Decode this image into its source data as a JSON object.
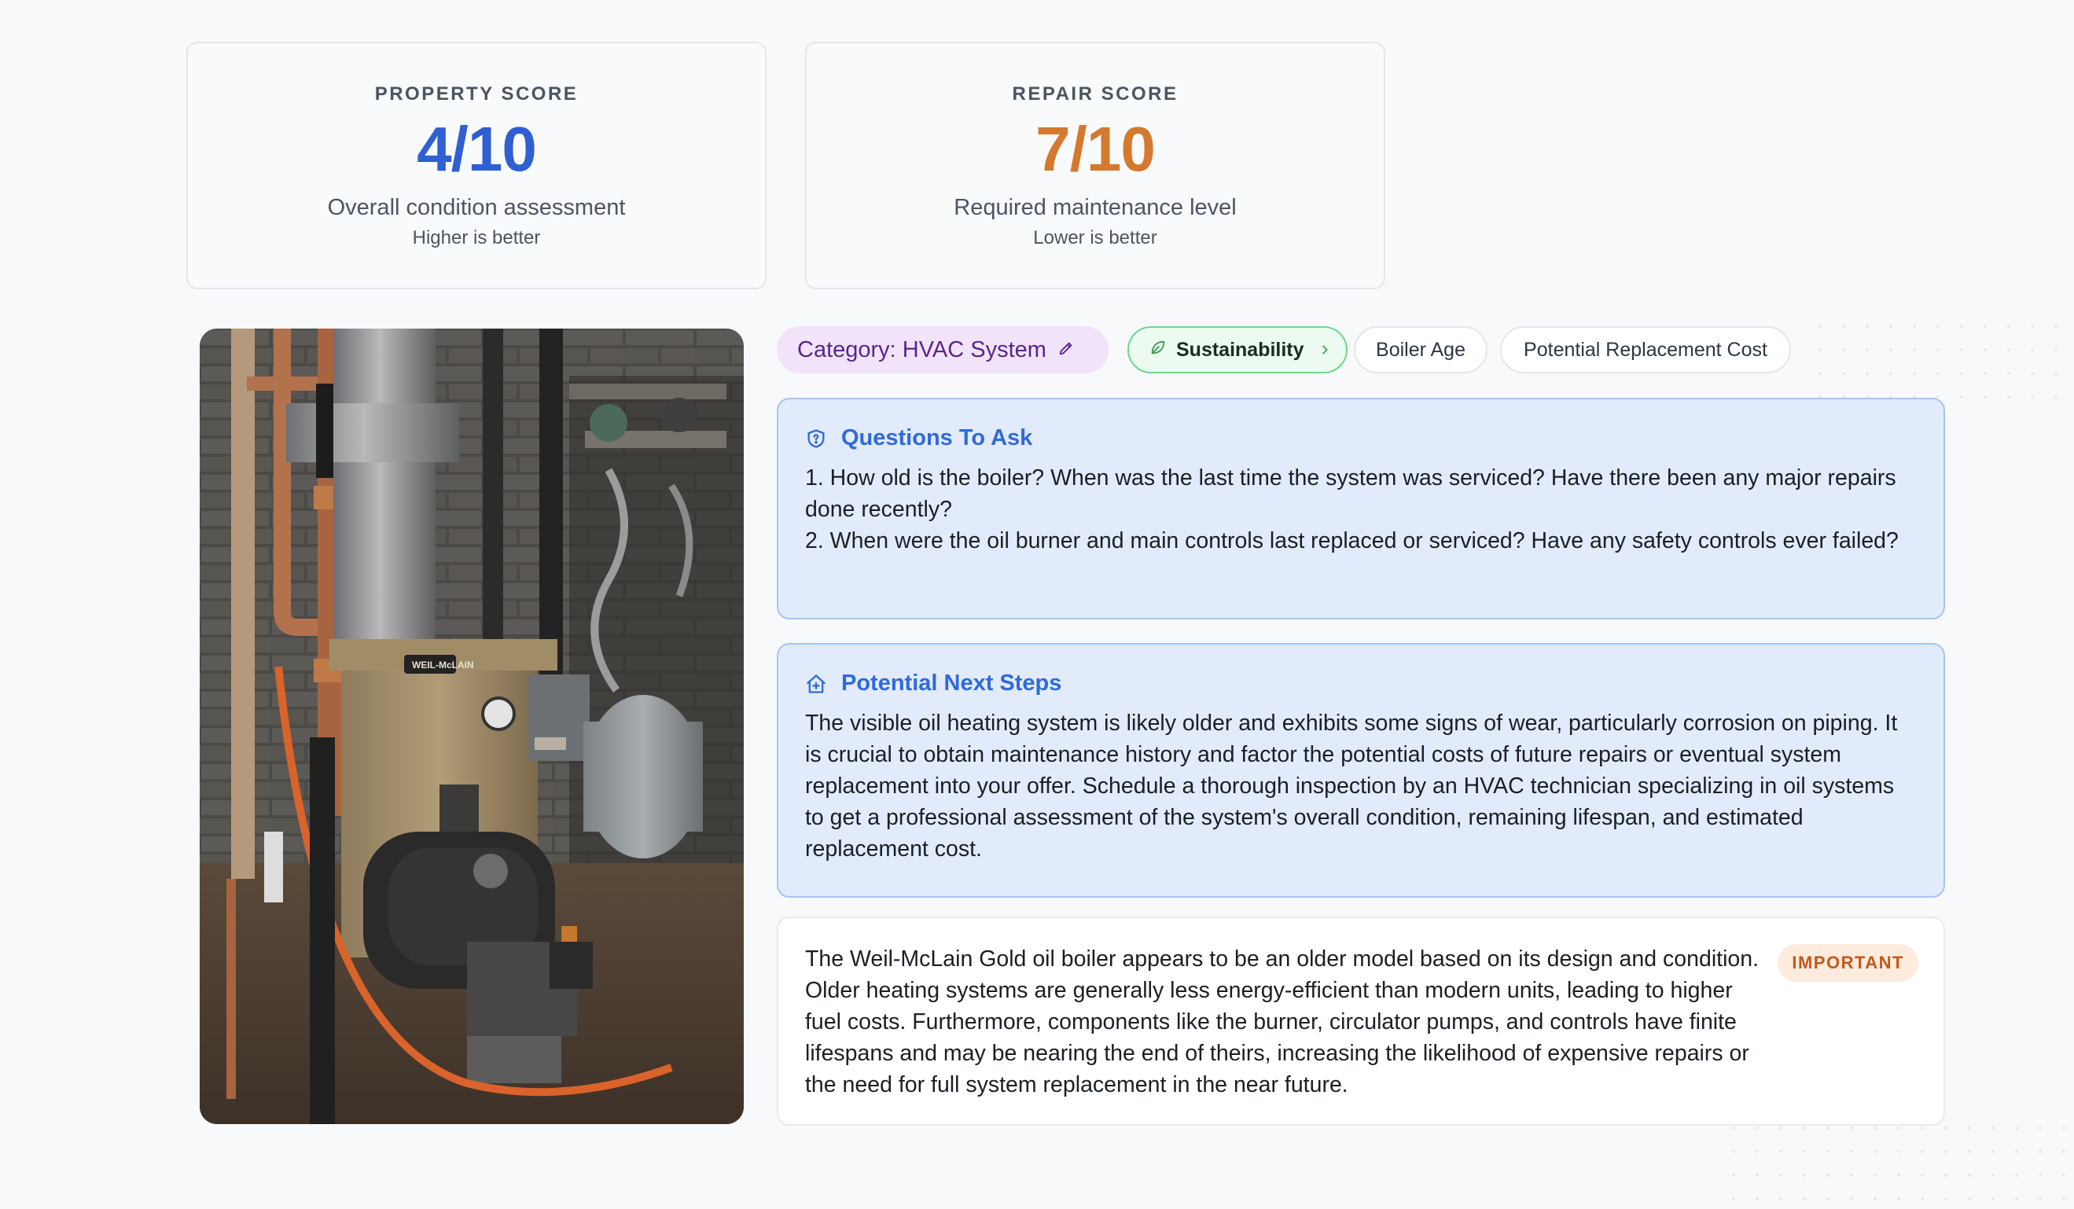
{
  "scores": {
    "property": {
      "label": "PROPERTY SCORE",
      "value": "4/10",
      "description": "Overall condition assessment",
      "note": "Higher is better",
      "color": "#2f5fd3"
    },
    "repair": {
      "label": "REPAIR SCORE",
      "value": "7/10",
      "description": "Required maintenance level",
      "note": "Lower is better",
      "color": "#d4792d"
    }
  },
  "photo": {
    "subject": "oil boiler in basement",
    "boiler_badge": "WEIL-McLAIN"
  },
  "chips": {
    "category": "Category: HVAC System",
    "category_icon": "pencil-icon",
    "sustainability": "Sustainability",
    "sustainability_icon": "leaf-icon",
    "boiler_age": "Boiler Age",
    "replacement_cost": "Potential Replacement Cost"
  },
  "questions": {
    "title": "Questions To Ask",
    "icon": "shield-question-icon",
    "items": [
      "1. How old is the boiler? When was the last time the system was serviced? Have there been any major repairs done recently?",
      "2. When were the oil burner and main controls last replaced or serviced? Have any safety controls ever failed?"
    ]
  },
  "next_steps": {
    "title": "Potential Next Steps",
    "icon": "house-plus-icon",
    "text": "The visible oil heating system is likely older and exhibits some signs of wear, particularly corrosion on piping. It is crucial to obtain maintenance history and factor the potential costs of future repairs or eventual system replacement into your offer. Schedule a thorough inspection by an HVAC technician specializing in oil systems to get a professional assessment of the system's overall condition, remaining lifespan, and estimated replacement cost."
  },
  "observation": {
    "badge": "IMPORTANT",
    "text": "The Weil-McLain Gold oil boiler appears to be an older model based on its design and condition. Older heating systems are generally less energy-efficient than modern units, leading to higher fuel costs. Furthermore, components like the burner, circulator pumps, and controls have finite lifespans and may be nearing the end of theirs, increasing the likelihood of expensive repairs or the need for full system replacement in the near future."
  }
}
